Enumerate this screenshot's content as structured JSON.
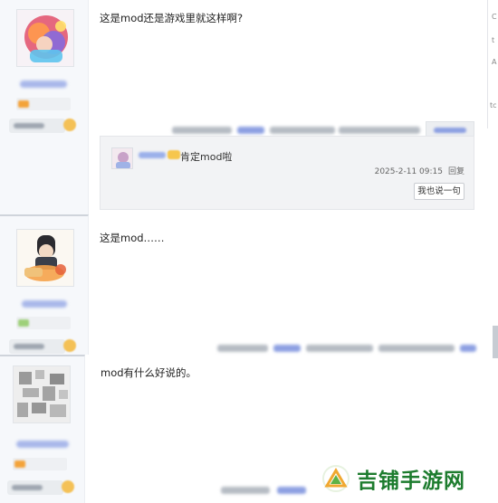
{
  "posts": [
    {
      "content": "这是mod还是游戏里就这样啊?",
      "reply": {
        "text": "肯定mod啦",
        "time": "2025-2-11 09:15",
        "reply_label": "回复",
        "say_button": "我也说一句"
      }
    },
    {
      "content": "这是mod……"
    },
    {
      "content": "mod有什么好说的。"
    }
  ],
  "side": {
    "chars": [
      "C",
      "",
      "t",
      "A",
      "",
      "tc"
    ]
  },
  "watermark": {
    "text": "吉铺手游网"
  },
  "colors": {
    "link_blue": "#8da0e2",
    "sidebar_bg": "#f6f8fb",
    "watermark_green": "#1d7c2e"
  }
}
